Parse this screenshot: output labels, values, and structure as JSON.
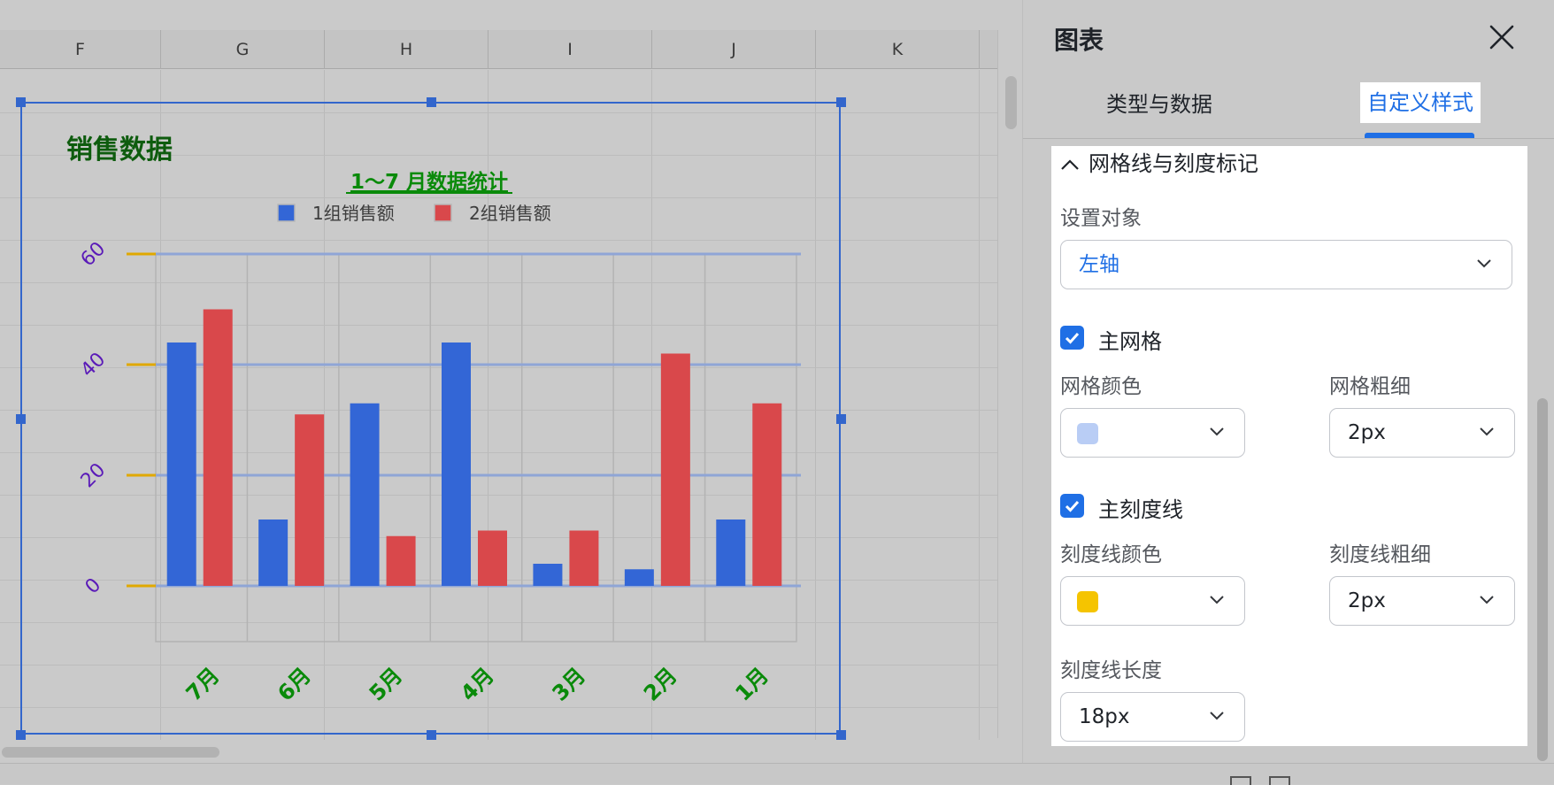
{
  "spreadsheet": {
    "columns": [
      "F",
      "G",
      "H",
      "I",
      "J",
      "K"
    ]
  },
  "chart": {
    "title": "销售数据",
    "subtitle": "1～7 月数据统计",
    "colors": {
      "series1": "#3366d6",
      "series2": "#d9484b",
      "title": "#0e5c0e",
      "subtitle": "#0a8a0a",
      "x_tick": "#0a8a0a",
      "y_tick": "#5a1ab8",
      "gridline": "#8fa5d6",
      "tick_mark": "#e0a800",
      "frame": "#3366cc"
    }
  },
  "chart_data": {
    "type": "bar",
    "title": "销售数据",
    "subtitle": "1～7 月数据统计",
    "categories": [
      "7月",
      "6月",
      "5月",
      "4月",
      "3月",
      "2月",
      "1月"
    ],
    "series": [
      {
        "name": "1组销售额",
        "values": [
          44,
          12,
          33,
          44,
          4,
          3,
          12
        ]
      },
      {
        "name": "2组销售额",
        "values": [
          50,
          31,
          9,
          10,
          10,
          42,
          33
        ]
      }
    ],
    "ylim": [
      0,
      60
    ],
    "yticks": [
      0,
      20,
      40,
      60
    ],
    "legend": "top",
    "grid": true
  },
  "panel": {
    "title": "图表",
    "tabs": {
      "data": "类型与数据",
      "style": "自定义样式"
    },
    "section": "网格线与刻度标记",
    "target_label": "设置对象",
    "target_value": "左轴",
    "major_grid_label": "主网格",
    "grid_color_label": "网格颜色",
    "grid_color": "#b9cdf5",
    "grid_width_label": "网格粗细",
    "grid_width_value": "2px",
    "major_tick_label": "主刻度线",
    "tick_color_label": "刻度线颜色",
    "tick_color": "#f5c400",
    "tick_width_label": "刻度线粗细",
    "tick_width_value": "2px",
    "tick_length_label": "刻度线长度",
    "tick_length_value": "18px"
  }
}
